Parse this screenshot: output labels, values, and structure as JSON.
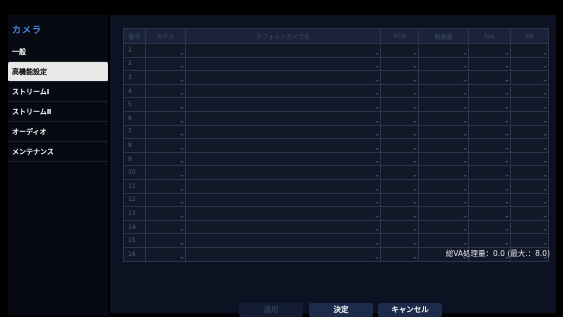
{
  "sidebar": {
    "title": "カメラ",
    "items": [
      {
        "label": "一般",
        "active": false
      },
      {
        "label": "高機能設定",
        "active": true
      },
      {
        "label": "ストリームⅠ",
        "active": false
      },
      {
        "label": "ストリームⅡ",
        "active": false
      },
      {
        "label": "オーディオ",
        "active": false
      },
      {
        "label": "メンテナンス",
        "active": false
      }
    ]
  },
  "grid": {
    "headers": [
      "番号",
      "モデル",
      "デフォルトカメラ名",
      "VCA",
      "解像度",
      "fps",
      "VA"
    ],
    "rows": [
      "1",
      "2",
      "3",
      "4",
      "5",
      "6",
      "7",
      "8",
      "9",
      "10",
      "11",
      "12",
      "13",
      "14",
      "15",
      "16"
    ]
  },
  "status": {
    "va_text": "総VA処理量：0.0 (最大.：8.0)"
  },
  "buttons": {
    "apply": "適用",
    "ok": "決定",
    "cancel": "キャンセル"
  },
  "colors": {
    "accent": "#4a86e0",
    "panel": "#0d1222",
    "button": "#1c2b4a"
  }
}
